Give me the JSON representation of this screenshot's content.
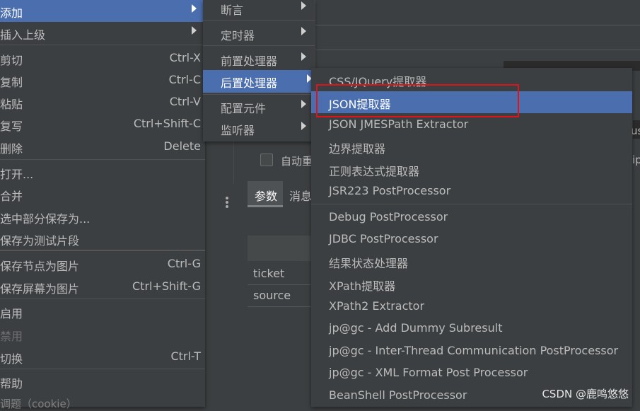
{
  "background": {
    "auto_label": "自动重",
    "tab_params": "参数",
    "tab_msg": "消息",
    "rows": [
      "ticket",
      "source"
    ],
    "partial_a": "us",
    "partial_b": "ip"
  },
  "context_menu": {
    "items": [
      {
        "label": "添加"
      },
      {
        "label": "插入上级"
      },
      {
        "label": "剪切",
        "shortcut": "Ctrl-X"
      },
      {
        "label": "复制",
        "shortcut": "Ctrl-C"
      },
      {
        "label": "粘贴",
        "shortcut": "Ctrl-V"
      },
      {
        "label": "复写",
        "shortcut": "Ctrl+Shift-C"
      },
      {
        "label": "删除",
        "shortcut": "Delete"
      },
      {
        "label": "打开..."
      },
      {
        "label": "合并"
      },
      {
        "label": "选中部分保存为..."
      },
      {
        "label": "保存为测试片段"
      },
      {
        "label": "保存节点为图片",
        "shortcut": "Ctrl-G"
      },
      {
        "label": "保存屏幕为图片",
        "shortcut": "Ctrl+Shift-G"
      },
      {
        "label": "启用"
      },
      {
        "label": "禁用"
      },
      {
        "label": "切换",
        "shortcut": "Ctrl-T"
      },
      {
        "label": "帮助"
      }
    ],
    "bottom_text": "调题（cookie）"
  },
  "add_submenu": {
    "items": [
      {
        "label": "断言"
      },
      {
        "label": "定时器"
      },
      {
        "label": "前置处理器"
      },
      {
        "label": "后置处理器"
      },
      {
        "label": "配置元件"
      },
      {
        "label": "监听器"
      }
    ]
  },
  "post_processor_menu": {
    "items": [
      {
        "label": "CSS/JQuery提取器"
      },
      {
        "label": "JSON提取器"
      },
      {
        "label": "JSON JMESPath Extractor"
      },
      {
        "label": "边界提取器"
      },
      {
        "label": "正则表达式提取器"
      },
      {
        "label": "JSR223 PostProcessor"
      },
      {
        "label": "Debug PostProcessor"
      },
      {
        "label": "JDBC PostProcessor"
      },
      {
        "label": "结果状态处理器"
      },
      {
        "label": "XPath提取器"
      },
      {
        "label": "XPath2 Extractor"
      },
      {
        "label": "jp@gc - Add Dummy Subresult"
      },
      {
        "label": "jp@gc - Inter-Thread Communication PostProcessor"
      },
      {
        "label": "jp@gc - XML Format Post Processor"
      },
      {
        "label": "BeanShell PostProcessor"
      }
    ]
  },
  "watermark": "CSDN @鹿鸣悠悠",
  "colors": {
    "highlight": "#4b6eaf",
    "annotation": "#e0131b"
  }
}
